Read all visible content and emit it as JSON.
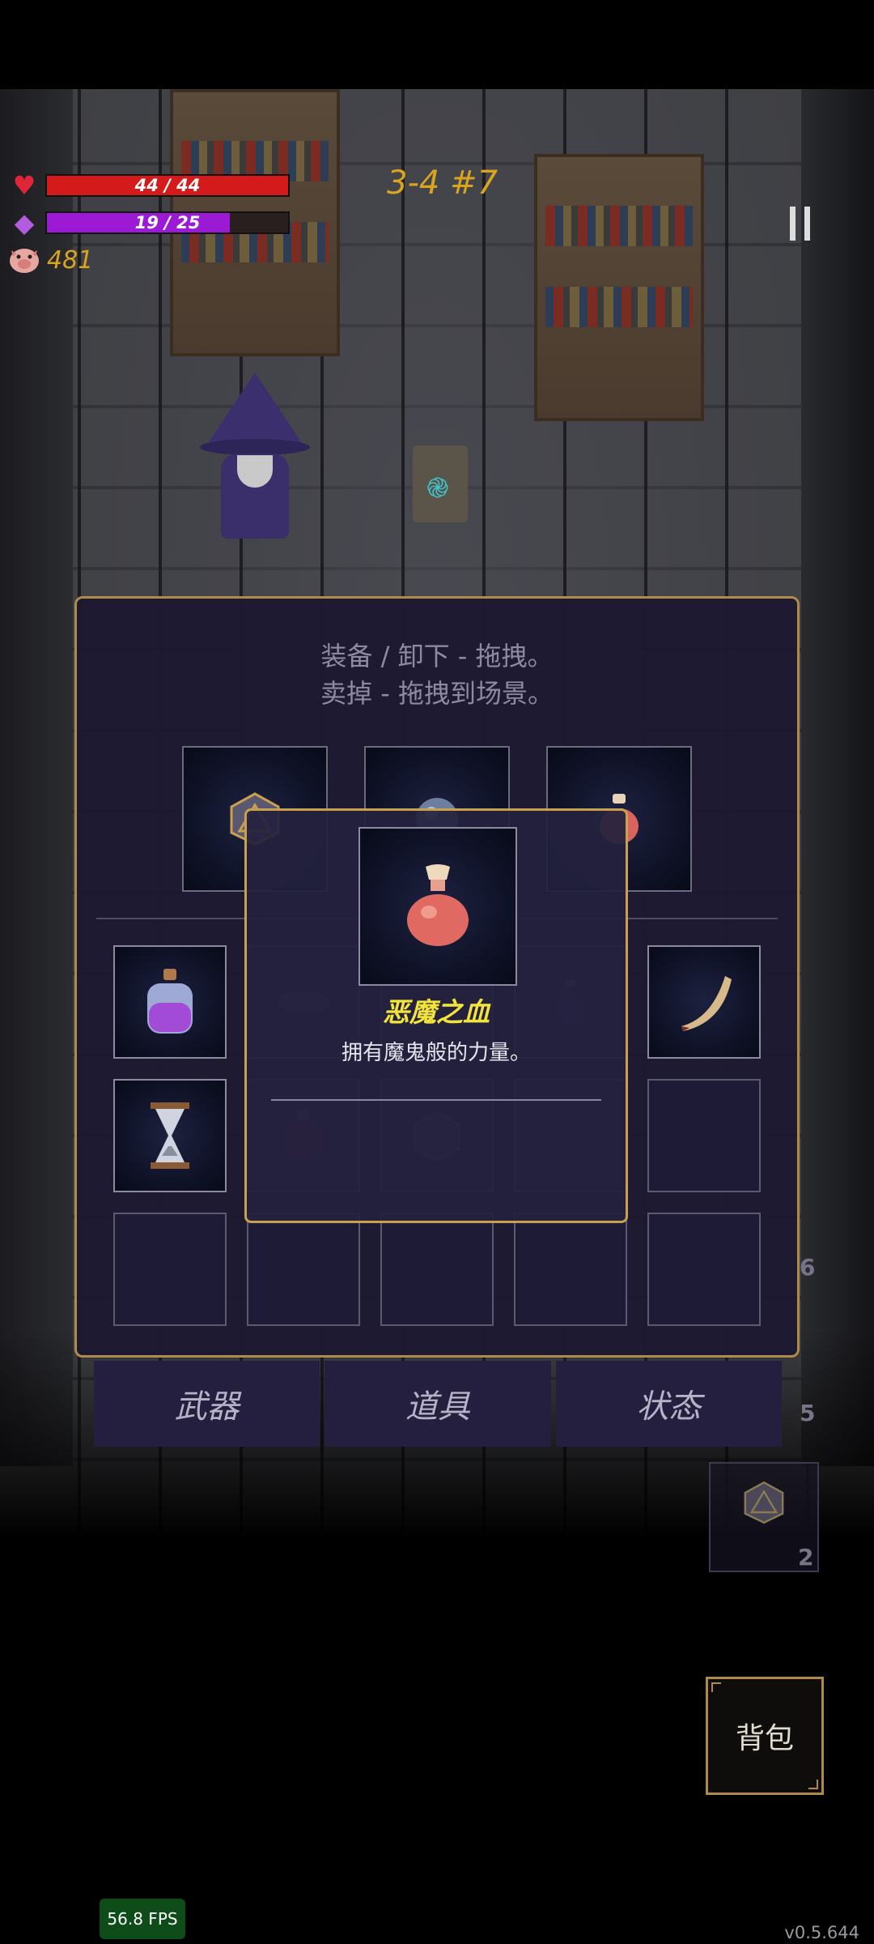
{
  "hud": {
    "hp": {
      "current": 44,
      "max": 44,
      "label": "44 / 44",
      "color": "#d41a1a",
      "icon": "heart-icon"
    },
    "mp": {
      "current": 19,
      "max": 25,
      "label": "19 / 25",
      "color": "#9c1ad4",
      "icon": "mana-crystal-icon"
    },
    "gold": {
      "value": "481",
      "icon": "pig-coin-icon"
    },
    "stage": "3-4 #7",
    "pause_icon": "pause-icon"
  },
  "inventory": {
    "instructions": [
      "装备 / 卸下 - 拖拽。",
      "卖掉 - 拖拽到场景。"
    ],
    "equipped": [
      {
        "icon": "d20-dice-icon"
      },
      {
        "icon": "orb-icon"
      },
      {
        "icon": "red-potion-icon"
      }
    ],
    "rows": [
      [
        {
          "icon": "purple-potion-icon",
          "filled": true
        },
        {
          "icon": "leaf-icon",
          "filled": false
        },
        {
          "icon": "empty",
          "filled": false
        },
        {
          "icon": "small-potion-icon",
          "filled": false
        },
        {
          "icon": "horn-icon",
          "filled": true
        }
      ],
      [
        {
          "icon": "hourglass-icon",
          "filled": true
        },
        {
          "icon": "red-potion-icon",
          "filled": false
        },
        {
          "icon": "cube-dice-icon",
          "filled": false
        },
        {
          "icon": "empty",
          "filled": false
        },
        {
          "icon": "empty",
          "filled": false
        }
      ],
      [
        {
          "icon": "empty",
          "filled": false
        },
        {
          "icon": "empty",
          "filled": false
        },
        {
          "icon": "empty",
          "filled": false
        },
        {
          "icon": "empty",
          "filled": false
        },
        {
          "icon": "empty",
          "filled": false
        }
      ]
    ]
  },
  "tooltip": {
    "name": "恶魔之血",
    "description": "拥有魔鬼般的力量。",
    "icon": "red-potion-icon",
    "name_color": "#f2e43a"
  },
  "tabs": [
    "武器",
    "道具",
    "状态"
  ],
  "side": {
    "numbers": [
      "6",
      "5",
      "2"
    ],
    "slot_icon": "d20-dice-icon"
  },
  "bag_button": "背包",
  "fps": "56.8 FPS",
  "version": "v0.5.644",
  "colors": {
    "accent_gold": "#b08a4a",
    "panel": "#1c1932"
  }
}
